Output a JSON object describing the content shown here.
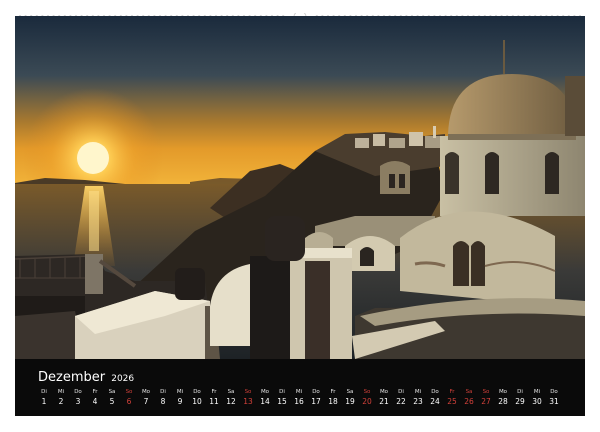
{
  "calendar": {
    "month": "Dezember",
    "year": "2026",
    "days": [
      {
        "weekday": "Di",
        "num": "1",
        "red": false
      },
      {
        "weekday": "Mi",
        "num": "2",
        "red": false
      },
      {
        "weekday": "Do",
        "num": "3",
        "red": false
      },
      {
        "weekday": "Fr",
        "num": "4",
        "red": false
      },
      {
        "weekday": "Sa",
        "num": "5",
        "red": false
      },
      {
        "weekday": "So",
        "num": "6",
        "red": true
      },
      {
        "weekday": "Mo",
        "num": "7",
        "red": false
      },
      {
        "weekday": "Di",
        "num": "8",
        "red": false
      },
      {
        "weekday": "Mi",
        "num": "9",
        "red": false
      },
      {
        "weekday": "Do",
        "num": "10",
        "red": false
      },
      {
        "weekday": "Fr",
        "num": "11",
        "red": false
      },
      {
        "weekday": "Sa",
        "num": "12",
        "red": false
      },
      {
        "weekday": "So",
        "num": "13",
        "red": true
      },
      {
        "weekday": "Mo",
        "num": "14",
        "red": false
      },
      {
        "weekday": "Di",
        "num": "15",
        "red": false
      },
      {
        "weekday": "Mi",
        "num": "16",
        "red": false
      },
      {
        "weekday": "Do",
        "num": "17",
        "red": false
      },
      {
        "weekday": "Fr",
        "num": "18",
        "red": false
      },
      {
        "weekday": "Sa",
        "num": "19",
        "red": false
      },
      {
        "weekday": "So",
        "num": "20",
        "red": true
      },
      {
        "weekday": "Mo",
        "num": "21",
        "red": false
      },
      {
        "weekday": "Di",
        "num": "22",
        "red": false
      },
      {
        "weekday": "Mi",
        "num": "23",
        "red": false
      },
      {
        "weekday": "Do",
        "num": "24",
        "red": false
      },
      {
        "weekday": "Fr",
        "num": "25",
        "red": true
      },
      {
        "weekday": "Sa",
        "num": "26",
        "red": true
      },
      {
        "weekday": "So",
        "num": "27",
        "red": true
      },
      {
        "weekday": "Mo",
        "num": "28",
        "red": false
      },
      {
        "weekday": "Di",
        "num": "29",
        "red": false
      },
      {
        "weekday": "Mi",
        "num": "30",
        "red": false
      },
      {
        "weekday": "Do",
        "num": "31",
        "red": false
      }
    ]
  },
  "colors": {
    "holiday": "#d2413a",
    "calendar_bg": "#0a0a0a",
    "sun": "#ffdc6a"
  }
}
